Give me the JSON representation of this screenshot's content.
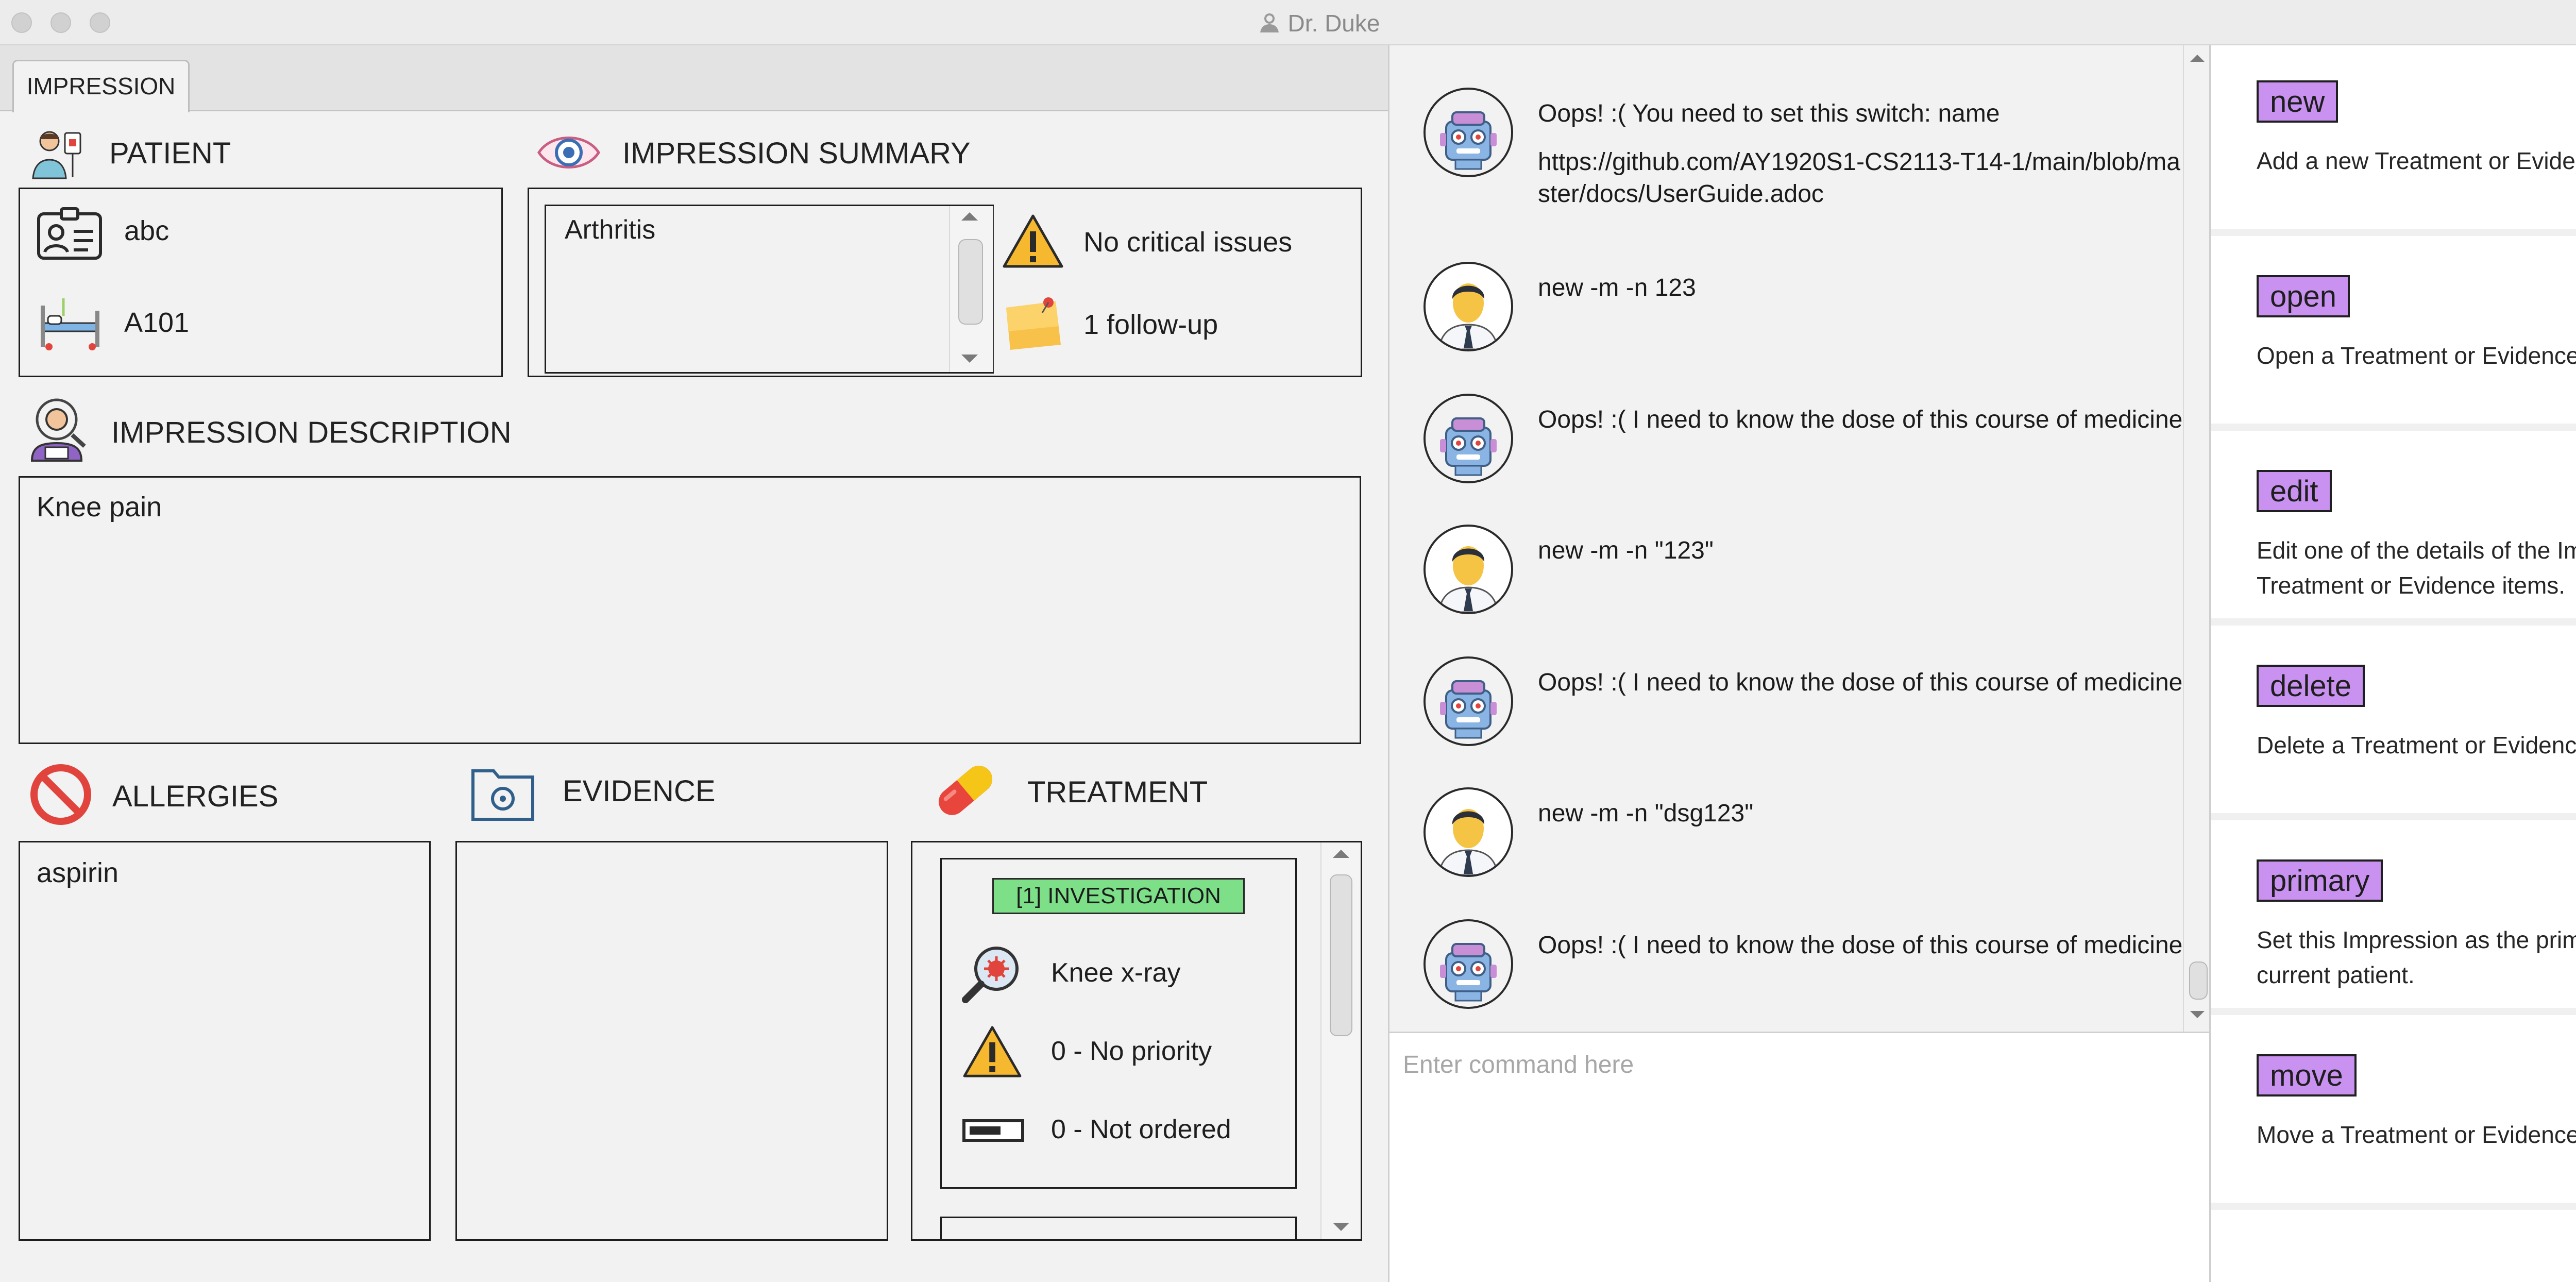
{
  "window": {
    "title": "Dr. Duke"
  },
  "tabs": [
    {
      "label": "IMPRESSION"
    }
  ],
  "patient": {
    "title": "PATIENT",
    "name": "abc",
    "bed": "A101"
  },
  "summary": {
    "title": "IMPRESSION SUMMARY",
    "impression_name": "Arthritis",
    "critical": "No critical issues",
    "followup": "1 follow-up"
  },
  "description": {
    "title": "IMPRESSION DESCRIPTION",
    "text": "Knee pain"
  },
  "allergies": {
    "title": "ALLERGIES",
    "items": [
      "aspirin"
    ]
  },
  "evidence": {
    "title": "EVIDENCE"
  },
  "treatment": {
    "title": "TREATMENT",
    "card": {
      "header": "[1] INVESTIGATION",
      "name": "Knee x-ray",
      "priority": "0 - No priority",
      "status": "0 - Not ordered"
    }
  },
  "chat": {
    "messages": [
      {
        "from": "bot",
        "lines": [
          "Oops! :( You need to set this switch: name",
          "https://github.com/AY1920S1-CS2113-T14-1/main/blob/master/docs/UserGuide.adoc"
        ]
      },
      {
        "from": "user",
        "lines": [
          "new -m -n 123"
        ]
      },
      {
        "from": "bot",
        "lines": [
          "Oops! :( I need to know the dose of this course of medicine!"
        ]
      },
      {
        "from": "user",
        "lines": [
          "new -m -n \"123\""
        ]
      },
      {
        "from": "bot",
        "lines": [
          "Oops! :( I need to know the dose of this course of medicine!"
        ]
      },
      {
        "from": "user",
        "lines": [
          "new -m -n \"dsg123\""
        ]
      },
      {
        "from": "bot",
        "lines": [
          "Oops! :( I need to know the dose of this course of medicine!"
        ]
      }
    ]
  },
  "command": {
    "placeholder": "Enter command here",
    "value": ""
  },
  "help": [
    {
      "cmd": "new",
      "desc": "Add a new Treatment or Evidence"
    },
    {
      "cmd": "open",
      "desc": "Open a Treatment or Evidence iten"
    },
    {
      "cmd": "edit",
      "desc": "Edit one of the details of the Impres\nTreatment or Evidence items."
    },
    {
      "cmd": "delete",
      "desc": "Delete a Treatment or Evidence ite"
    },
    {
      "cmd": "primary",
      "desc": "Set this Impression as the primary\ncurrent patient."
    },
    {
      "cmd": "move",
      "desc": "Move a Treatment or Evidence to a"
    }
  ],
  "colors": {
    "help_button": "#c991f0",
    "investigation_header": "#7de089",
    "allergy_icon": "#e0443c",
    "pill_red": "#e8453c",
    "pill_yellow": "#f5c518",
    "warning": "#f5b82e"
  }
}
